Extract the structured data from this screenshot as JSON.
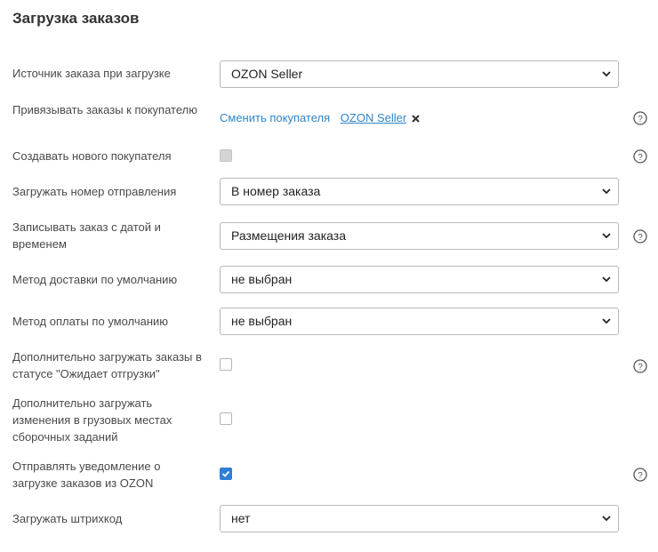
{
  "title": "Загрузка заказов",
  "rows": {
    "source": {
      "label": "Источник заказа при загрузке",
      "value": "OZON Seller"
    },
    "bind_buyer": {
      "label": "Привязывать заказы к покупателю",
      "change_link": "Сменить покупателя",
      "buyer_link": "OZON Seller"
    },
    "create_buyer": {
      "label": "Создавать нового покупателя",
      "checked": false,
      "disabled": true
    },
    "shipment_number": {
      "label": "Загружать номер отправления",
      "value": "В номер заказа"
    },
    "order_datetime": {
      "label": "Записывать заказ с датой и временем",
      "value": "Размещения заказа"
    },
    "delivery_method": {
      "label": "Метод доставки по умолчанию",
      "value": "не выбран"
    },
    "payment_method": {
      "label": "Метод оплаты по умолчанию",
      "value": "не выбран"
    },
    "awaiting_shipment": {
      "label": "Дополнительно загружать заказы в статусе \"Ожидает отгрузки\"",
      "checked": false
    },
    "cargo_changes": {
      "label": "Дополнительно загружать изменения в грузовых местах сборочных заданий",
      "checked": false
    },
    "notify": {
      "label": "Отправлять уведомление о загрузке заказов из OZON",
      "checked": true
    },
    "barcode": {
      "label": "Загружать штрихкод",
      "value": "нет"
    }
  },
  "colors": {
    "link": "#2e86c9",
    "checkbox_checked": "#2f7ed8",
    "help_icon": "#555555"
  }
}
